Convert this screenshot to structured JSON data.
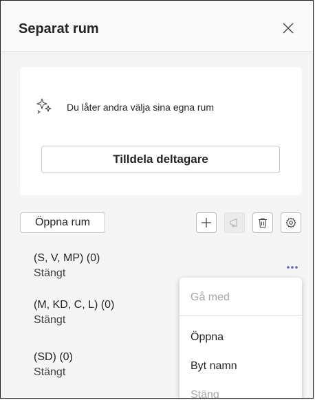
{
  "panel": {
    "title": "Separat rum"
  },
  "card": {
    "info_text": "Du låter andra välja sina egna rum",
    "assign_button": "Tilldela deltagare"
  },
  "toolbar": {
    "open_rooms_button": "Öppna rum",
    "icons": [
      "add-icon",
      "announce-icon",
      "delete-icon",
      "settings-icon"
    ]
  },
  "rooms": [
    {
      "name": "(S, V, MP)  (0)",
      "status": "Stängt"
    },
    {
      "name": "(M, KD, C, L)  (0)",
      "status": "Stängt"
    },
    {
      "name": "(SD)  (0)",
      "status": "Stängt"
    }
  ],
  "context_menu": {
    "items": [
      {
        "label": "Gå med",
        "disabled": true
      },
      {
        "label": "Öppna",
        "disabled": false
      },
      {
        "label": "Byt namn",
        "disabled": false
      },
      {
        "label": "Stäng",
        "disabled": true
      }
    ]
  },
  "colors": {
    "accent": "#5b5fc7",
    "text": "#242424",
    "disabled_text": "#a6a6a6"
  }
}
